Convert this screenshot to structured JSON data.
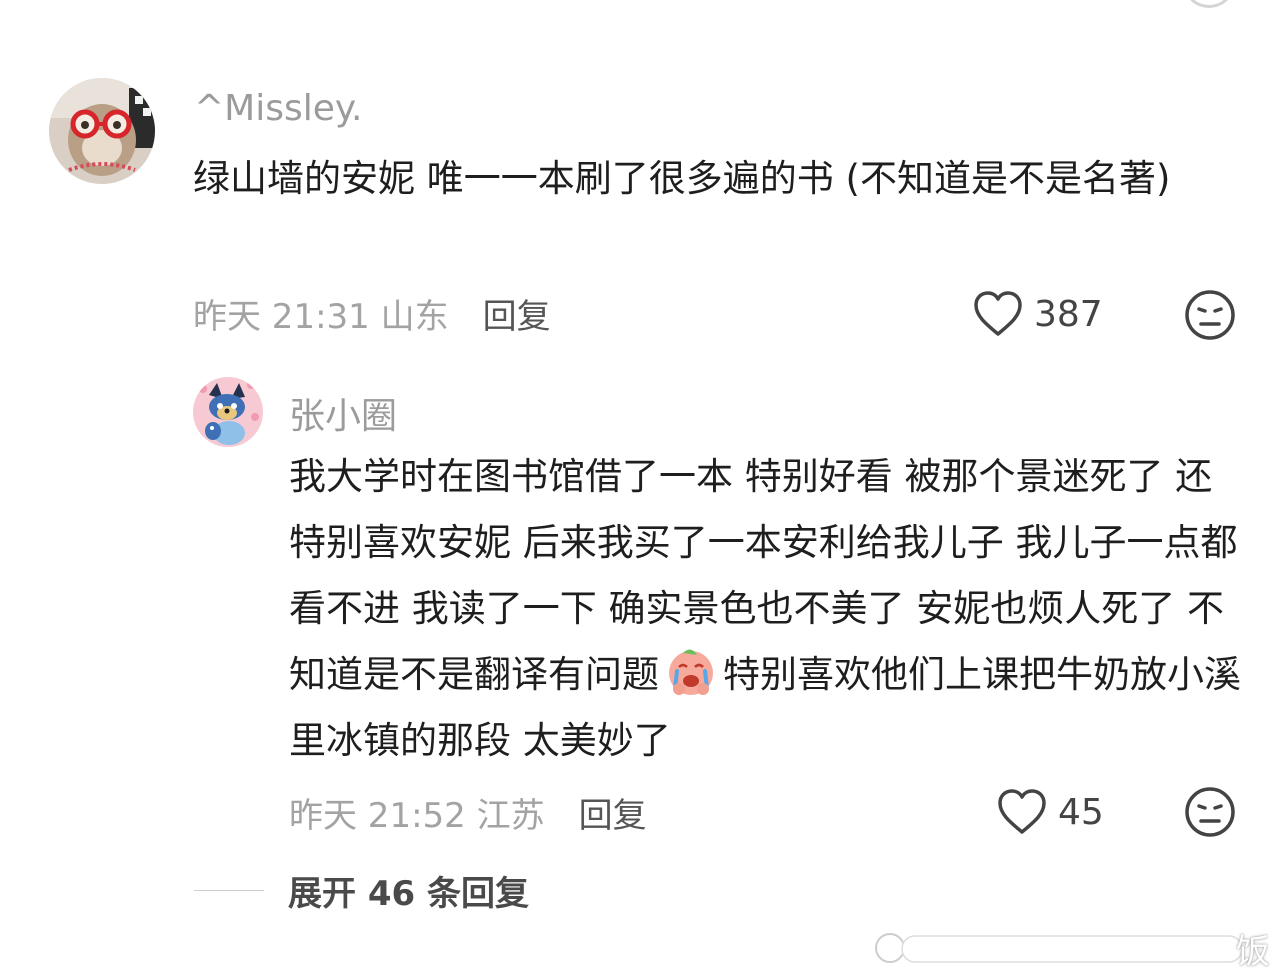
{
  "comments": [
    {
      "username": "^Missley.",
      "text": "绿山墙的安妮 唯一一本刷了很多遍的书 (不知道是不是名著)",
      "time_location": "昨天 21:31 山东",
      "reply_label": "回复",
      "likes": "387"
    }
  ],
  "replies": [
    {
      "username": "张小圈",
      "text_before_emoji": "我大学时在图书馆借了一本 特别好看 被那个景迷死了 还特别喜欢安妮 后来我买了一本安利给我儿子 我儿子一点都看不进 我读了一下 确实景色也不美了 安妮也烦人死了 不知道是不是翻译有问题",
      "text_after_emoji": "特别喜欢他们上课把牛奶放小溪里冰镇的那段 太美妙了",
      "time_location": "昨天 21:52 江苏",
      "reply_label": "回复",
      "likes": "45"
    }
  ],
  "expand_label": "展开 46 条回复",
  "icons": {
    "like": "heart-outline-icon",
    "dislike": "meh-face-icon",
    "emoji": "crying-emoji-icon"
  },
  "colors": {
    "username": "#9b9b9b",
    "text": "#1e1e1e",
    "meta": "#a3a3a3"
  },
  "watermark": "饭"
}
